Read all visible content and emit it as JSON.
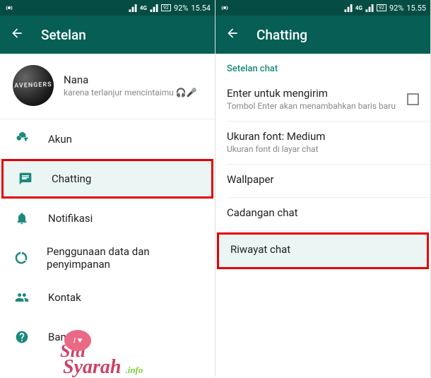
{
  "statusbar": {
    "signal_label": "4G",
    "battery_icon": "92",
    "battery_text": "92%",
    "time": "15.54",
    "time_right": "15.55"
  },
  "left": {
    "toolbar_title": "Setelan",
    "profile": {
      "avatar_text": "AVENGERS",
      "name": "Nana",
      "status": "karena terlanjur mencintaimu 🎧🎤"
    },
    "menu": {
      "akun": "Akun",
      "chatting": "Chatting",
      "notifikasi": "Notifikasi",
      "data": "Penggunaan data dan penyimpanan",
      "kontak": "Kontak",
      "bantuan": "Bantuan"
    }
  },
  "right": {
    "toolbar_title": "Chatting",
    "section": "Setelan chat",
    "enter_send": {
      "title": "Enter untuk mengirim",
      "sub": "Tombol Enter akan menambahkan baris baru"
    },
    "font": {
      "title": "Ukuran font: Medium",
      "sub": "Ukuran font di layar chat"
    },
    "wallpaper": "Wallpaper",
    "backup": "Cadangan chat",
    "history": "Riwayat chat"
  },
  "watermark": {
    "bubble": "I ♥",
    "line1": "Siti",
    "line2": "Syarah",
    "info": ".info"
  }
}
